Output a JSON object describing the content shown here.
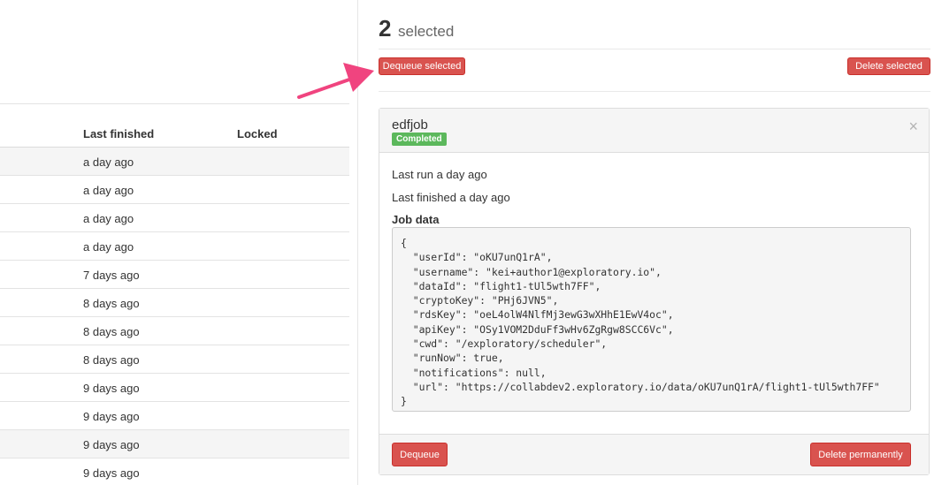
{
  "table": {
    "columns": {
      "last_finished": "Last finished",
      "locked": "Locked"
    },
    "rows": [
      {
        "last_finished": "a day ago",
        "shaded": true
      },
      {
        "last_finished": "a day ago",
        "shaded": false
      },
      {
        "last_finished": "a day ago",
        "shaded": false
      },
      {
        "last_finished": "a day ago",
        "shaded": false
      },
      {
        "last_finished": "7 days ago",
        "shaded": false
      },
      {
        "last_finished": "8 days ago",
        "shaded": false
      },
      {
        "last_finished": "8 days ago",
        "shaded": false
      },
      {
        "last_finished": "8 days ago",
        "shaded": false
      },
      {
        "last_finished": "9 days ago",
        "shaded": false
      },
      {
        "last_finished": "9 days ago",
        "shaded": false
      },
      {
        "last_finished": "9 days ago",
        "shaded": true
      },
      {
        "last_finished": "9 days ago",
        "shaded": false
      }
    ]
  },
  "selection": {
    "count": "2",
    "label": "selected",
    "dequeue_selected_label": "Dequeue selected",
    "delete_selected_label": "Delete selected"
  },
  "job": {
    "name": "edfjob",
    "status": "Completed",
    "close_glyph": "×",
    "last_run": "Last run a day ago",
    "last_finished": "Last finished a day ago",
    "job_data_label": "Job data",
    "job_data": "{\n  \"userId\": \"oKU7unQ1rA\",\n  \"username\": \"kei+author1@exploratory.io\",\n  \"dataId\": \"flight1-tUl5wth7FF\",\n  \"cryptoKey\": \"PHj6JVN5\",\n  \"rdsKey\": \"oeL4olW4NlfMj3ewG3wXHhE1EwV4oc\",\n  \"apiKey\": \"OSy1VOM2DduFf3wHv6ZgRgw8SCC6Vc\",\n  \"cwd\": \"/exploratory/scheduler\",\n  \"runNow\": true,\n  \"notifications\": null,\n  \"url\": \"https://collabdev2.exploratory.io/data/oKU7unQ1rA/flight1-tUl5wth7FF\"\n}",
    "dequeue_label": "Dequeue",
    "delete_permanently_label": "Delete permanently"
  },
  "colors": {
    "danger": "#d9534f",
    "success": "#5cb85c",
    "annotation_arrow": "#f0447f"
  },
  "icons": {
    "close": "close-icon",
    "annotation": "arrow-icon"
  }
}
